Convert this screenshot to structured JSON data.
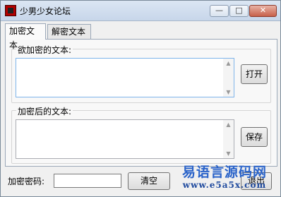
{
  "window": {
    "title": "少男少女论坛",
    "minimize": "—",
    "maximize": "□",
    "close": "✕"
  },
  "tabs": [
    {
      "label": "加密文本"
    },
    {
      "label": "解密文本"
    }
  ],
  "encrypt_panel": {
    "input_group_label": "欲加密的文本:",
    "input_text": "",
    "open_button": "打开",
    "output_group_label": "加密后的文本:",
    "output_text": "",
    "save_button": "保存"
  },
  "footer": {
    "password_label": "加密密码:",
    "password_value": "",
    "clear_button": "清空",
    "exit_button": "退出"
  },
  "watermark": {
    "line1": "易语言源码网",
    "line2": "www.e5a5x.com"
  }
}
